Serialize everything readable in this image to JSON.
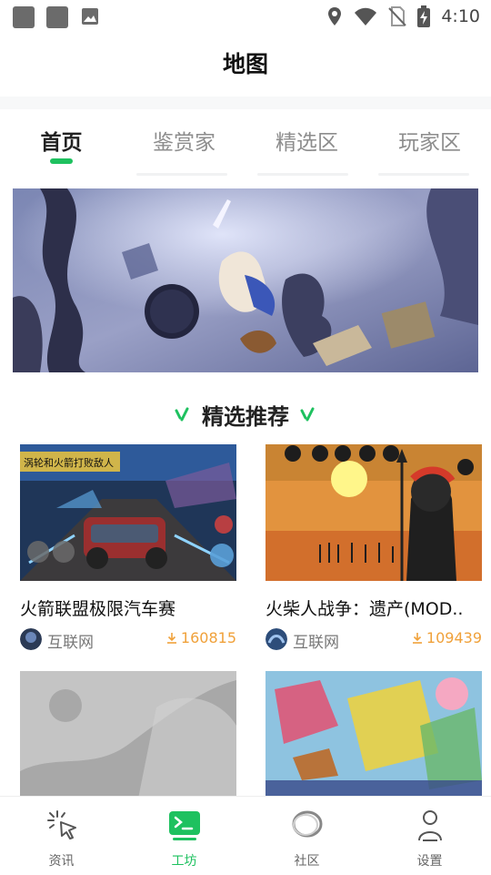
{
  "status_bar": {
    "time": "4:10",
    "icons": [
      "notification-square-icon",
      "notification-square-icon",
      "image-icon",
      "location-icon",
      "wifi-icon",
      "no-sim-icon",
      "battery-charging-icon"
    ]
  },
  "header": {
    "title": "地图"
  },
  "tabs": [
    {
      "label": "首页",
      "active": true
    },
    {
      "label": "鉴赏家",
      "active": false
    },
    {
      "label": "精选区",
      "active": false
    },
    {
      "label": "玩家区",
      "active": false
    }
  ],
  "banner": {
    "icon": "game-artwork"
  },
  "section": {
    "title": "精选推荐"
  },
  "cards": [
    {
      "title": "火箭联盟极限汽车赛",
      "source": "互联网",
      "downloads": "160815",
      "thumb_text": "涡轮和火箭打败敌人"
    },
    {
      "title": "火柴人战争：遗产(MOD..",
      "source": "互联网",
      "downloads": "109439"
    },
    {
      "title": "",
      "source": "",
      "downloads": ""
    },
    {
      "title": "",
      "source": "",
      "downloads": ""
    }
  ],
  "bottom_nav": [
    {
      "label": "资讯",
      "icon": "cursor-click-icon",
      "active": false
    },
    {
      "label": "工坊",
      "icon": "terminal-icon",
      "active": true
    },
    {
      "label": "社区",
      "icon": "ring-icon",
      "active": false
    },
    {
      "label": "设置",
      "icon": "person-icon",
      "active": false
    }
  ],
  "colors": {
    "accent": "#1ec15f",
    "download": "#f0a13a",
    "text_dark": "#222222",
    "text_muted": "#8d8d8d"
  }
}
